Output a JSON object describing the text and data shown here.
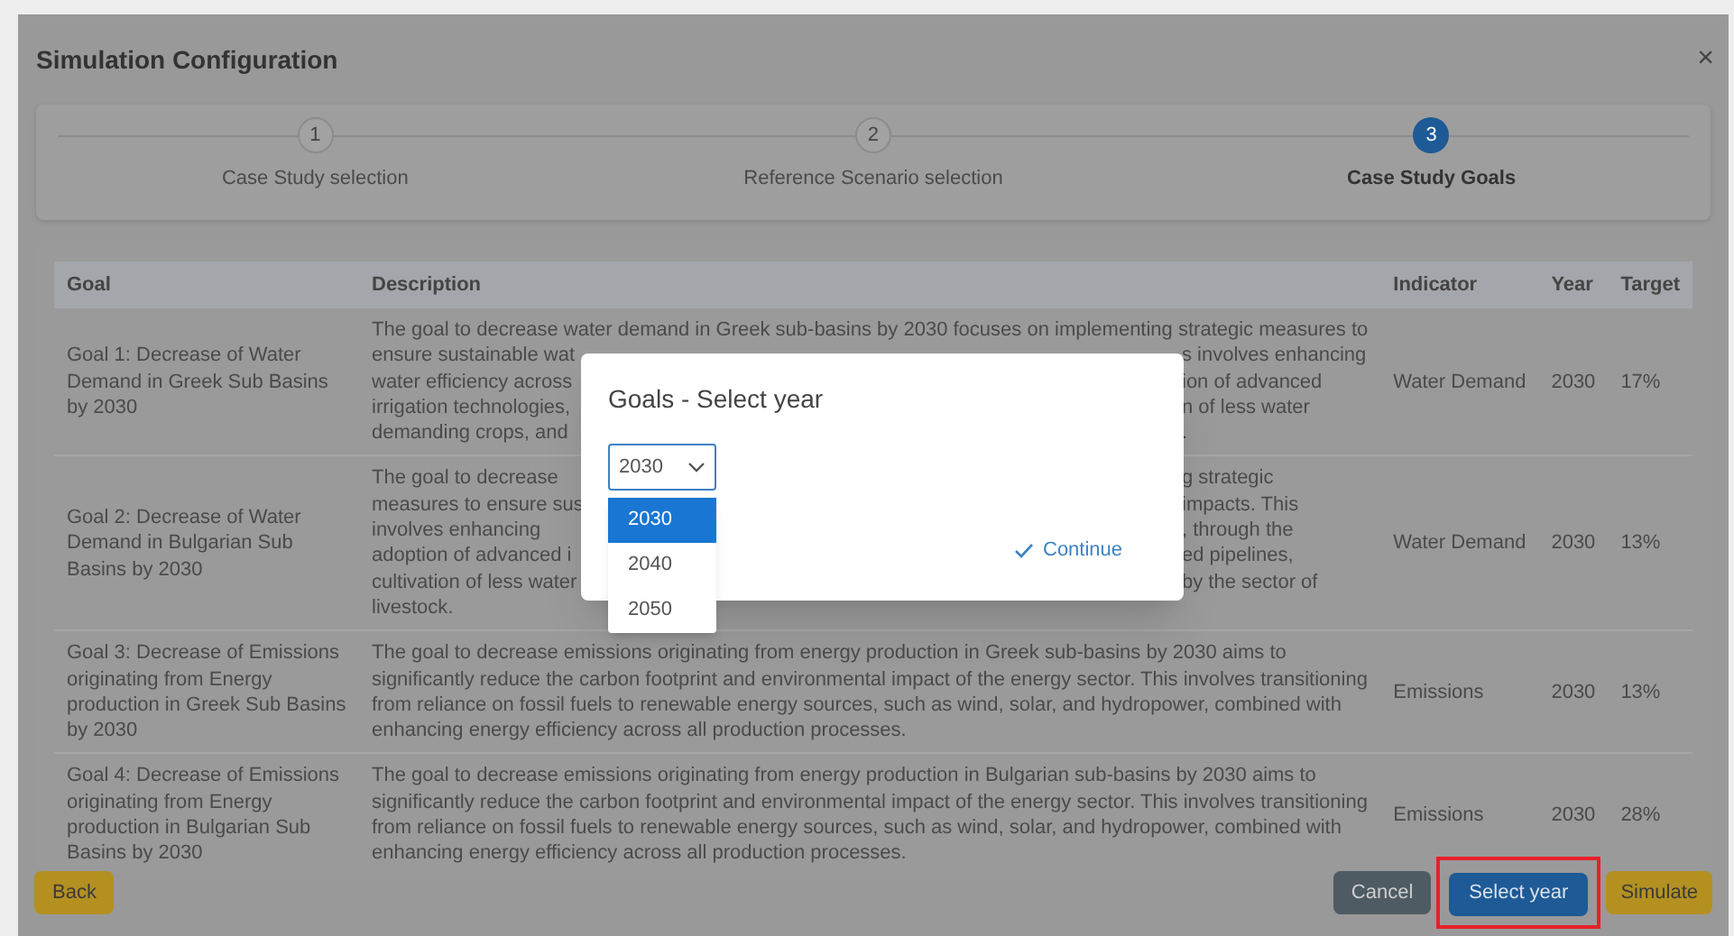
{
  "dialog": {
    "title": "Simulation Configuration",
    "close": "×"
  },
  "steps": [
    {
      "number": "1",
      "label": "Case Study selection",
      "selected": false
    },
    {
      "number": "2",
      "label": "Reference Scenario selection",
      "selected": false
    },
    {
      "number": "3",
      "label": "Case Study Goals",
      "selected": true
    }
  ],
  "table": {
    "columns": [
      "Goal",
      "Description",
      "Indicator",
      "Year",
      "Target"
    ],
    "rows": [
      {
        "goal": "Goal 1: Decrease of Water Demand in Greek Sub Basins by 2030",
        "description_lines": [
          {
            "left": "The goal to decrease water demand in Greek sub-basins by 2030 focuses on implementing strategic measures to"
          },
          {
            "left": "ensure sustainable wat",
            "right": "s involves enhancing"
          },
          {
            "left": "water efficiency across",
            "right": "ion of advanced"
          },
          {
            "left": "irrigation technologies,",
            "right": "n of less water"
          },
          {
            "left": "demanding crops, and",
            "right": "."
          }
        ],
        "indicator": "Water Demand",
        "year": "2030",
        "target": "17%"
      },
      {
        "goal": "Goal 2: Decrease of Water Demand in Bulgarian Sub Basins by 2030",
        "description_lines": [
          {
            "left": "The goal to decrease",
            "right": "g strategic"
          },
          {
            "left": "measures to ensure sus",
            "right": "impacts. This"
          },
          {
            "left": "involves enhancing",
            "right": ", through the"
          },
          {
            "left": "adoption of advanced i",
            "right": "ed pipelines,"
          },
          {
            "left": "cultivation of less water",
            "right": "by the sector of"
          },
          {
            "left": "livestock."
          }
        ],
        "indicator": "Water Demand",
        "year": "2030",
        "target": "13%"
      },
      {
        "goal": "Goal 3: Decrease of Emissions originating from Energy production in Greek Sub Basins by 2030",
        "description": "The goal to decrease emissions originating from energy production in Greek sub-basins by 2030 aims to significantly reduce the carbon footprint and environmental impact of the energy sector. This involves transitioning from reliance on fossil fuels to renewable energy sources, such as wind, solar, and hydropower, combined with enhancing energy efficiency across all production processes.",
        "indicator": "Emissions",
        "year": "2030",
        "target": "13%"
      },
      {
        "goal": "Goal 4: Decrease of Emissions originating from Energy production in Bulgarian Sub Basins by 2030",
        "description": "The goal to decrease emissions originating from energy production in Bulgarian sub-basins by 2030 aims to significantly reduce the carbon footprint and environmental impact of the energy sector. This involves transitioning from reliance on fossil fuels to renewable energy sources, such as wind, solar, and hydropower, combined with enhancing energy efficiency across all production processes.",
        "indicator": "Emissions",
        "year": "2030",
        "target": "28%"
      }
    ]
  },
  "buttons": [
    {
      "label": "Back",
      "kind": "back",
      "highlighted": false
    },
    {
      "label": "Cancel",
      "kind": "cancel",
      "highlighted": false
    },
    {
      "label": "Select year",
      "kind": "primary",
      "highlighted": true
    },
    {
      "label": "Simulate",
      "kind": "simulate",
      "highlighted": false
    }
  ],
  "modal": {
    "title": "Goals - Select year",
    "select": {
      "value": "2030",
      "expanded": true,
      "options": [
        {
          "label": "2030",
          "selected": true
        },
        {
          "label": "2040",
          "selected": false
        },
        {
          "label": "2050",
          "selected": false
        }
      ]
    },
    "continue": "Continue"
  }
}
